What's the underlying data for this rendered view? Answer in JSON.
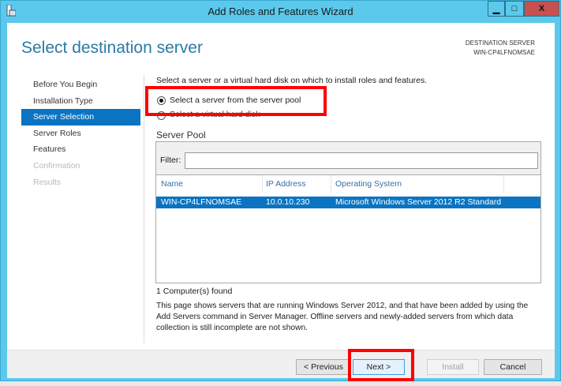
{
  "window": {
    "title": "Add Roles and Features Wizard",
    "minimize": "▁",
    "maximize": "□",
    "close": "X"
  },
  "header": {
    "title": "Select destination server",
    "dest_label": "DESTINATION SERVER",
    "dest_value": "WIN-CP4LFNOMSAE"
  },
  "nav": {
    "items": [
      {
        "label": "Before You Begin",
        "state": "normal"
      },
      {
        "label": "Installation Type",
        "state": "normal"
      },
      {
        "label": "Server Selection",
        "state": "selected"
      },
      {
        "label": "Server Roles",
        "state": "normal"
      },
      {
        "label": "Features",
        "state": "normal"
      },
      {
        "label": "Confirmation",
        "state": "disabled"
      },
      {
        "label": "Results",
        "state": "disabled"
      }
    ]
  },
  "main": {
    "instruction": "Select a server or a virtual hard disk on which to install roles and features.",
    "option_pool": "Select a server from the server pool",
    "option_vhd": "Select a virtual hard disk",
    "pool_title": "Server Pool",
    "filter_label": "Filter:",
    "filter_value": "",
    "columns": [
      "Name",
      "IP Address",
      "Operating System"
    ],
    "rows": [
      {
        "name": "WIN-CP4LFNOMSAE",
        "ip": "10.0.10.230",
        "os": "Microsoft Windows Server 2012 R2 Standard"
      }
    ],
    "count": "1 Computer(s) found",
    "desc1": "This page shows servers that are running Windows Server 2012, and that have been added by using the",
    "desc2": "Add Servers command in Server Manager. Offline servers and newly-added servers from which data",
    "desc3": "collection is still incomplete are not shown."
  },
  "footer": {
    "previous": "< Previous",
    "next": "Next >",
    "install": "Install",
    "cancel": "Cancel"
  },
  "colors": {
    "accent": "#0a74c2",
    "highlight": "#ff0000",
    "frame": "#5bc9ec"
  }
}
